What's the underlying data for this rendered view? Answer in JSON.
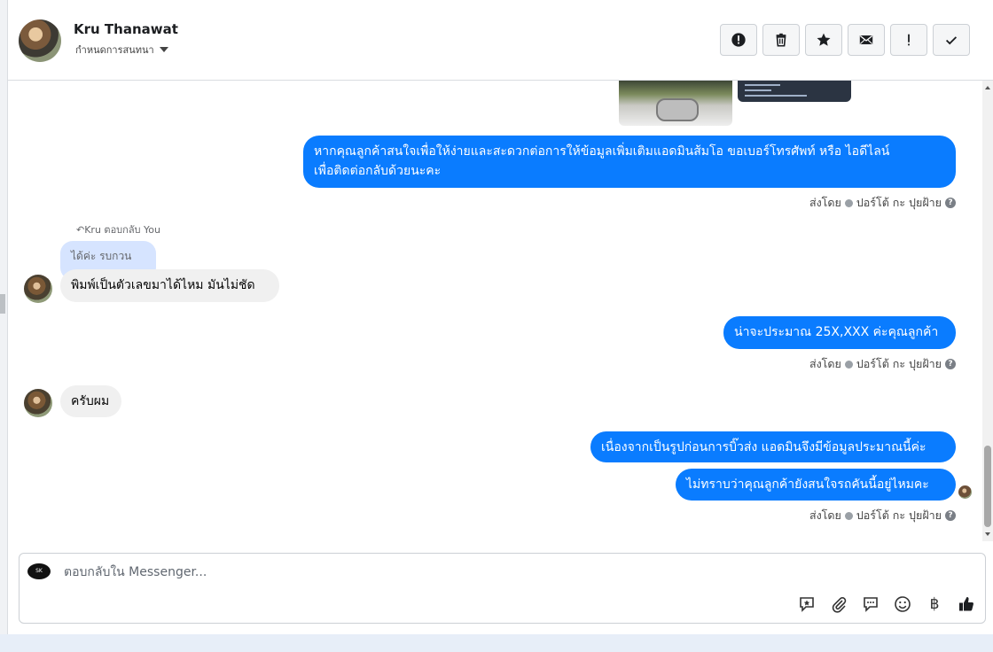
{
  "header": {
    "contact_name": "Kru Thanawat",
    "assign_label": "กำหนดการสนทนา"
  },
  "actions": [
    {
      "name": "spam-button",
      "icon": "alert-circle-icon"
    },
    {
      "name": "delete-button",
      "icon": "trash-icon"
    },
    {
      "name": "follow-up-button",
      "icon": "star-icon"
    },
    {
      "name": "mark-unread-button",
      "icon": "envelope-icon"
    },
    {
      "name": "priority-button",
      "icon": "exclamation-icon"
    },
    {
      "name": "mark-done-button",
      "icon": "check-icon"
    }
  ],
  "messages": {
    "out1_line1": "หากคุณลูกค้าสนใจเพื่อให้ง่ายและสะดวกต่อการให้ข้อมูลเพิ่มเติมแอดมินส้มโอ ขอเบอร์โทรศัพท์ หรือ ไอดีไลน์",
    "out1_line2": "เพื่อติดต่อกลับด้วยนะคะ",
    "reply_meta": "Kru ตอบกลับ You",
    "reply_quote": "ได้ค่ะ รบกวน",
    "in1": "พิมพ์เป็นตัวเลขมาได้ไหม มันไม่ชัด",
    "out2": "น่าจะประมาณ 25X,XXX  ค่ะคุณลูกค้า",
    "in2": "ครับผม",
    "out3": "เนื่องจากเป็นรูปก่อนการบิ๊วส่ง แอดมินจึงมีข้อมูลประมาณนี้ค่ะ",
    "out4": "ไม่ทราบว่าคุณลูกค้ายังสนใจรถคันนี้อยู่ไหมคะ"
  },
  "sent_by": {
    "prefix": "ส่งโดย",
    "agent": "ปอร์โต้ กะ ปุยฝ้าย",
    "help": "?"
  },
  "composer": {
    "placeholder": "ตอบกลับใน Messenger...",
    "logo_text": "SK",
    "currency_symbol": "฿"
  },
  "colors": {
    "outgoing_bubble": "#0a7cff",
    "incoming_bubble": "#f0f0f0",
    "reply_quote_bg": "#d6e4ff"
  }
}
